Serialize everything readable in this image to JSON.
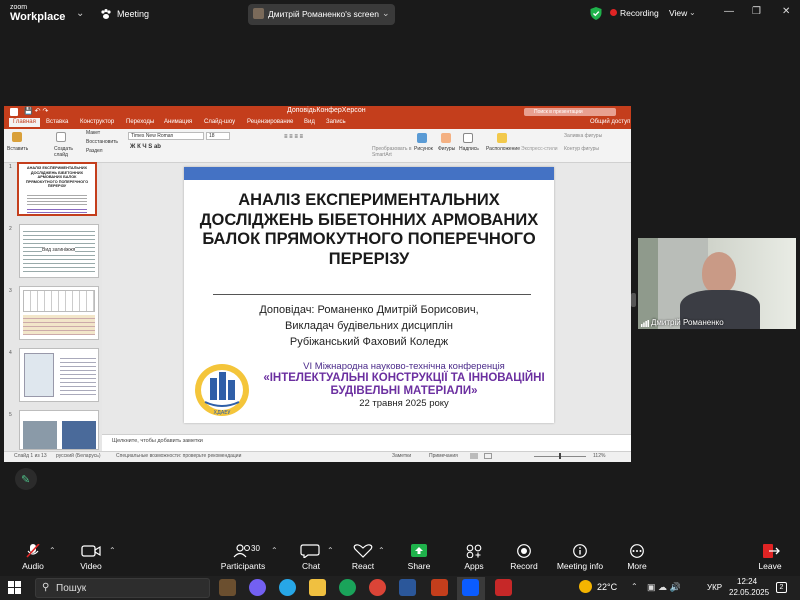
{
  "topbar": {
    "logo_small": "zoom",
    "logo_big": "Workplace",
    "meeting_label": "Meeting",
    "screen_share_label": "Дмитрій Романенко's screen",
    "recording_label": "Recording",
    "view_label": "View"
  },
  "ppt": {
    "file_title": "ДоповідьКонферХерсон",
    "search_placeholder": "Поиск в презентации",
    "tabs": [
      "Главная",
      "Вставка",
      "Конструктор",
      "Переходы",
      "Анимация",
      "Слайд-шоу",
      "Рецензирование",
      "Вид",
      "Запись"
    ],
    "share_label": "Общий доступ",
    "ribbon": {
      "paste": "Вставить",
      "new_slide": "Создать слайд",
      "layout": "Макет",
      "reset": "Восстановить",
      "section": "Раздел",
      "font_name": "Times New Roman",
      "font_size": "18",
      "smartart": "Преобразовать в SmartArt",
      "picture": "Рисунок",
      "shapes": "Фигуры",
      "textbox": "Надпись",
      "arrange": "Расположение",
      "quick_styles": "Экспресс-стили",
      "shape_fill": "Заливка фигуры",
      "shape_outline": "Контур фигуры"
    },
    "notes_placeholder": "Щелкните, чтобы добавить заметки",
    "status": {
      "slide_count": "Слайд 1 из 13",
      "language": "русский (Беларусь)",
      "accessibility": "Специальные возможности: проверьте рекомендации",
      "notes": "Заметки",
      "comments": "Примечания",
      "zoom": "112%"
    },
    "thumb_numbers": [
      "1",
      "2",
      "3",
      "4",
      "5"
    ],
    "thumb1_text": "АНАЛІЗ ЕКСПЕРИМЕНТАЛЬНИХ ДОСЛІДЖЕНЬ БІБЕТОННИХ АРМОВАНИХ БАЛОК ПРЯМОКУТНОГО ПОПЕРЕЧНОГО ПЕРЕРІЗУ",
    "thumb2_text": "Вид загиніжжя"
  },
  "slide": {
    "title": "АНАЛІЗ ЕКСПЕРИМЕНТАЛЬНИХ ДОСЛІДЖЕНЬ  БІБЕТОННИХ АРМОВАНИХ  БАЛОК ПРЯМОКУТНОГО ПОПЕРЕЧНОГО ПЕРЕРІЗУ",
    "speaker_line": "Доповідач: Романенко Дмитрій Борисович,",
    "role_line": "Викладач будівельних дисциплін",
    "college_line": "Рубіжанський Фаховий Коледж",
    "conf_line1": "VI Міжнародна науково-технічна конференція",
    "conf_line2": "«ІНТЕЛЕКТУАЛЬНІ КОНСТРУКЦІЇ ТА ІННОВАЦІЙНІ БУДІВЕЛЬНІ МАТЕРІАЛИ»",
    "conf_date": "22 травня 2025 року",
    "seal_text": "ХДАЕУ"
  },
  "video": {
    "participant_name": "Дмитрій Романенко"
  },
  "toolbar": {
    "audio": "Audio",
    "video": "Video",
    "participants": "Participants",
    "participants_count": "30",
    "chat": "Chat",
    "react": "React",
    "share": "Share",
    "apps": "Apps",
    "record": "Record",
    "meeting_info": "Meeting info",
    "more": "More",
    "leave": "Leave"
  },
  "taskbar": {
    "search": "Пошук",
    "temperature": "22°C",
    "language": "УКР",
    "time": "12:24",
    "date": "22.05.2025",
    "notifications": "2"
  },
  "colors": {
    "ppt_accent": "#c43e1c",
    "slide_band": "#4472c4",
    "conf_purple": "#6b2fa0",
    "share_green": "#1fb24b",
    "leave_red": "#e02424"
  }
}
